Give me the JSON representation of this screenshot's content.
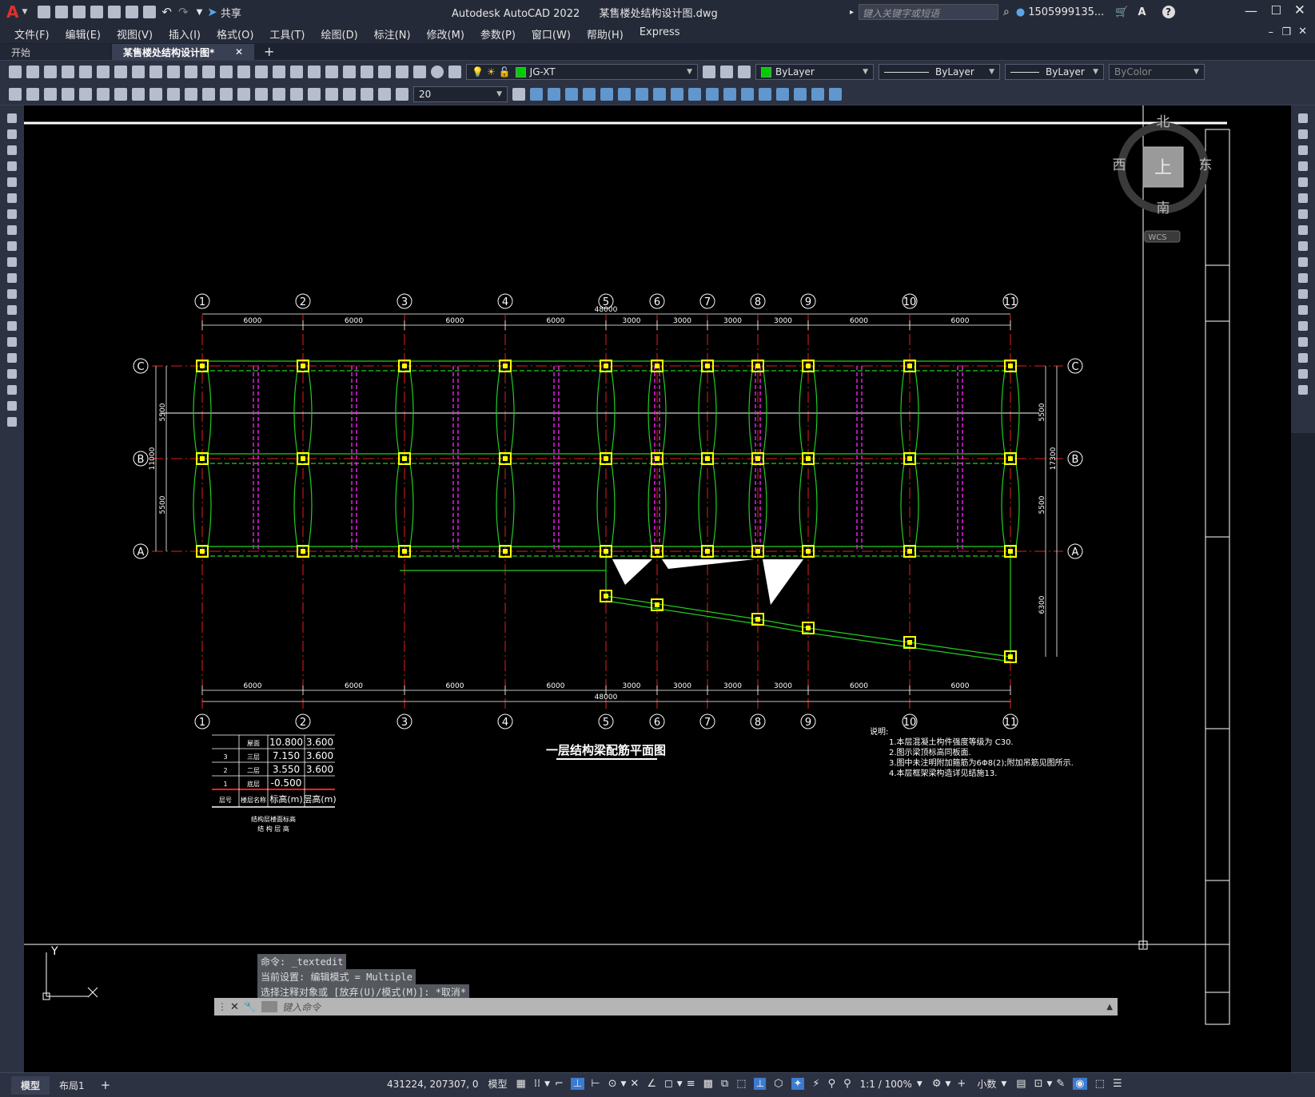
{
  "app": {
    "title": "Autodesk AutoCAD 2022",
    "file": "某售楼处结构设计图.dwg",
    "share_label": "共享",
    "search_placeholder": "键入关键字或短语",
    "user": "1505999135...",
    "logo": "A"
  },
  "menu": [
    "文件(F)",
    "编辑(E)",
    "视图(V)",
    "插入(I)",
    "格式(O)",
    "工具(T)",
    "绘图(D)",
    "标注(N)",
    "修改(M)",
    "参数(P)",
    "窗口(W)",
    "帮助(H)",
    "Express"
  ],
  "tabs": [
    {
      "label": "开始",
      "active": false
    },
    {
      "label": "某售楼处结构设计图*",
      "active": true
    }
  ],
  "toolbar": {
    "layer": "JG-XT",
    "layer_color": "#00cc00",
    "color_value": "ByLayer",
    "linetype_value": "ByLayer",
    "lineweight_value": "ByLayer",
    "plotstyle_value": "ByColor",
    "text_height": "20"
  },
  "viewcube": {
    "north": "北",
    "south": "南",
    "east": "东",
    "west": "西",
    "face": "上",
    "wcs": "WCS"
  },
  "drawing": {
    "title": "一层结构梁配筋平面图",
    "top_total": "48000",
    "bottom_total": "48000",
    "axes_numbers": [
      "1",
      "2",
      "3",
      "4",
      "5",
      "6",
      "7",
      "8",
      "9",
      "10",
      "11"
    ],
    "axes_letters": [
      "C",
      "B",
      "A"
    ],
    "top_dims": [
      "6000",
      "6000",
      "6000",
      "6000",
      "3000",
      "3000",
      "3000",
      "3000",
      "6000",
      "6000"
    ],
    "bottom_dims": [
      "6000",
      "6000",
      "6000",
      "6000",
      "3000",
      "3000",
      "3000",
      "3000",
      "6000",
      "6000"
    ],
    "left_dims": [
      "5500",
      "11000",
      "5500"
    ],
    "right_dims": [
      "5500",
      "5500",
      "17300",
      "6300"
    ],
    "notes": [
      "说明:",
      "1.本层混凝土构件强度等级为 C30.",
      "2.图示梁顶标高同板面.",
      "3.图中未注明附加箍筋为6Φ8(2);附加吊筋见图所示.",
      "4.本层框架梁构造详见结施13."
    ],
    "floor_table": {
      "rows": [
        {
          "no": "",
          "name": "屋面",
          "elev": "10.800",
          "height": "3.600"
        },
        {
          "no": "3",
          "name": "三层",
          "elev": "7.150",
          "height": "3.600"
        },
        {
          "no": "2",
          "name": "二层",
          "elev": "3.550",
          "height": "3.600"
        },
        {
          "no": "1",
          "name": "底层",
          "elev": "-0.500",
          "height": ""
        }
      ],
      "header": {
        "no": "层号",
        "name": "楼层名称",
        "elev": "标高(m)",
        "height": "层高(m)"
      },
      "caption1": "结构层楼面标高",
      "caption2": "结 构 层 高"
    }
  },
  "command": {
    "history": [
      "命令: _textedit",
      "当前设置: 编辑模式 = Multiple",
      "选择注释对象或 [放弃(U)/模式(M)]: *取消*"
    ],
    "placeholder": "键入命令"
  },
  "status": {
    "model_tab": "模型",
    "layout_tab": "布局1",
    "coords": "431224, 207307, 0",
    "model_label": "模型",
    "scale": "1:1 / 100%",
    "units": "小数"
  },
  "ucs": {
    "y": "Y"
  }
}
